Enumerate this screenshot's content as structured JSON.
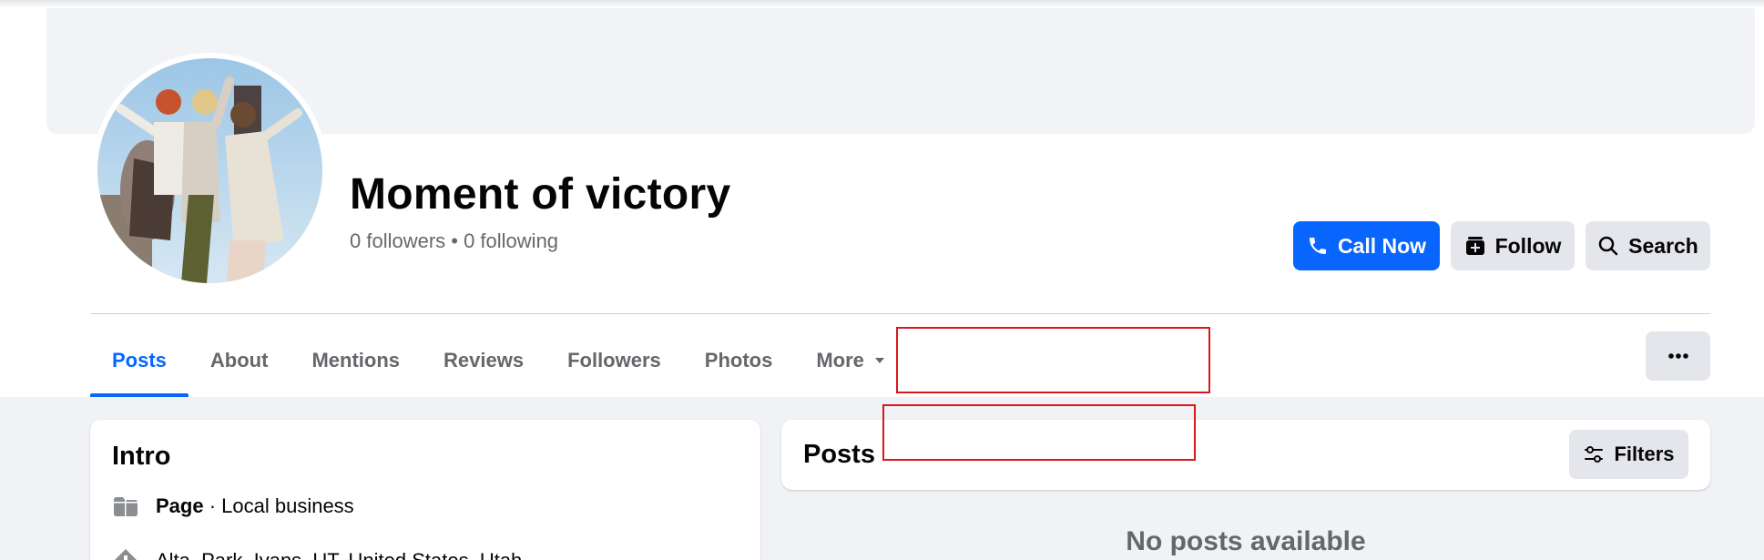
{
  "page": {
    "title": "Moment of victory",
    "stats": "0 followers • 0 following"
  },
  "actions": {
    "call_label": "Call Now",
    "follow_label": "Follow",
    "search_label": "Search"
  },
  "tabs": [
    {
      "label": "Posts",
      "active": true
    },
    {
      "label": "About"
    },
    {
      "label": "Mentions"
    },
    {
      "label": "Reviews"
    },
    {
      "label": "Followers"
    },
    {
      "label": "Photos"
    },
    {
      "label": "More"
    }
  ],
  "intro": {
    "title": "Intro",
    "page_type_bold": "Page",
    "page_type_rest": " · Local business",
    "address": "Alta, Park, Ivans, UT, United States, Utah"
  },
  "posts": {
    "title": "Posts",
    "filters_label": "Filters",
    "empty_message": "No posts available"
  },
  "icons": {
    "call": "phone-icon",
    "follow": "follow-icon",
    "search": "search-icon",
    "more_caret": "caret-down-icon",
    "more_menu": "ellipsis-icon",
    "filters": "sliders-icon",
    "page": "page-icon",
    "location": "location-icon"
  },
  "colors": {
    "accent": "#0866ff",
    "secondary_button": "#e4e6eb",
    "muted_text": "#65676b",
    "annotation_box": "#d9181e"
  }
}
